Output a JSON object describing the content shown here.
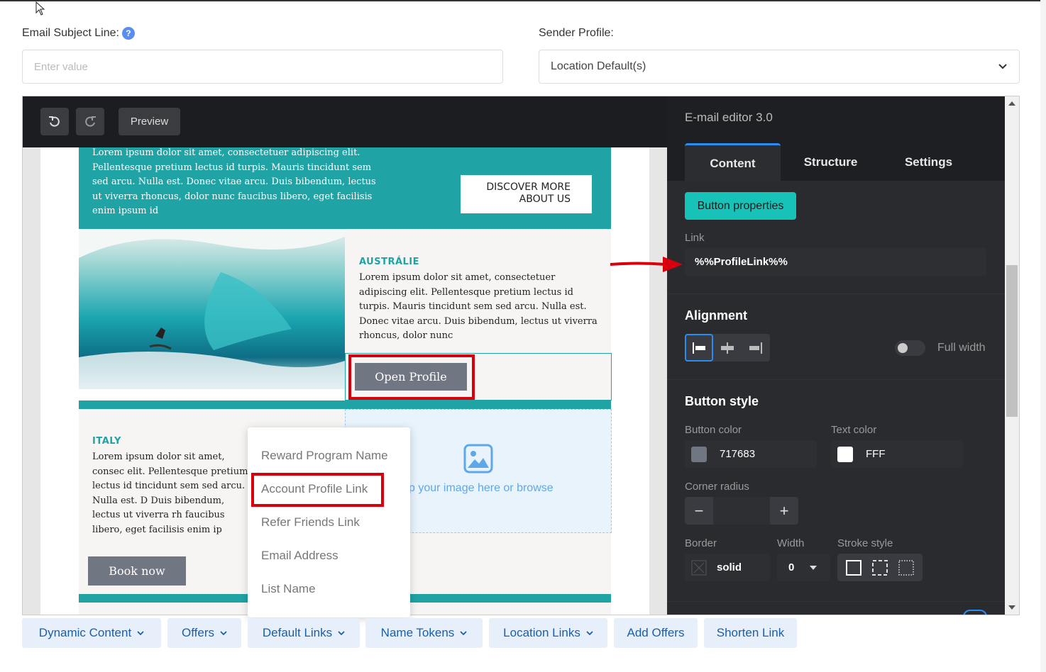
{
  "subject": {
    "label": "Email Subject Line:",
    "help": "?",
    "placeholder": "Enter value"
  },
  "sender": {
    "label": "Sender Profile:",
    "value": "Location Default(s)"
  },
  "toolbar": {
    "undo_icon": "undo-icon",
    "redo_icon": "redo-icon",
    "preview_label": "Preview"
  },
  "email": {
    "intro_text": "Lorem ipsum dolor sit amet, consectetuer adipiscing elit. Pellentesque pretium lectus id turpis. Mauris tincidunt sem sed arcu. Nulla est. Donec vitae arcu. Duis bibendum, lectus ut viverra rhoncus, dolor nunc faucibus libero, eget facilisis enim ipsum id",
    "discover_button": "DISCOVER MORE ABOUT US",
    "australia_title": "AUSTRÁLIE",
    "australia_text": "Lorem ipsum dolor sit amet, consectetuer adipiscing elit. Pellentesque pretium lectus id turpis. Mauris tincidunt sem sed arcu. Nulla est. Donec vitae arcu. Duis bibendum, lectus ut viverra rhoncus, dolor nunc",
    "open_profile_button": "Open Profile",
    "italy_title": "ITALY",
    "italy_text": "Lorem ipsum dolor sit amet, consec elit. Pellentesque pretium lectus id tincidunt sem sed arcu. Nulla est. D Duis bibendum, lectus ut viverra rh faucibus libero, eget facilisis enim ip",
    "book_now_button": "Book now",
    "image_drop_text": "p your image here or browse"
  },
  "sidebar": {
    "title": "E-mail editor 3.0",
    "tabs": [
      "Content",
      "Structure",
      "Settings"
    ],
    "active_block": "Button properties",
    "link_label": "Link",
    "link_value": "%%ProfileLink%%",
    "alignment_title": "Alignment",
    "full_width_label": "Full width",
    "button_style_title": "Button style",
    "button_color_label": "Button color",
    "button_color_value": "717683",
    "text_color_label": "Text color",
    "text_color_value": "FFF",
    "corner_radius_label": "Corner radius",
    "minus": "−",
    "plus": "+",
    "border_label": "Border",
    "border_value": "solid",
    "width_label": "Width",
    "width_value": "0",
    "stroke_label": "Stroke style"
  },
  "dropdown": {
    "items": [
      "Reward Program Name",
      "Account Profile Link",
      "Refer Friends Link",
      "Email Address",
      "List Name"
    ]
  },
  "bottom_bar": {
    "chips": [
      "Dynamic Content",
      "Offers",
      "Default Links",
      "Name Tokens",
      "Location Links",
      "Add Offers",
      "Shorten Link"
    ]
  },
  "colors": {
    "teal": "#1fa3a5",
    "button_gray": "#717683",
    "accent_blue": "#2d8cf0",
    "highlight_red": "#d9000d",
    "button_properties": "#17c3b8"
  }
}
